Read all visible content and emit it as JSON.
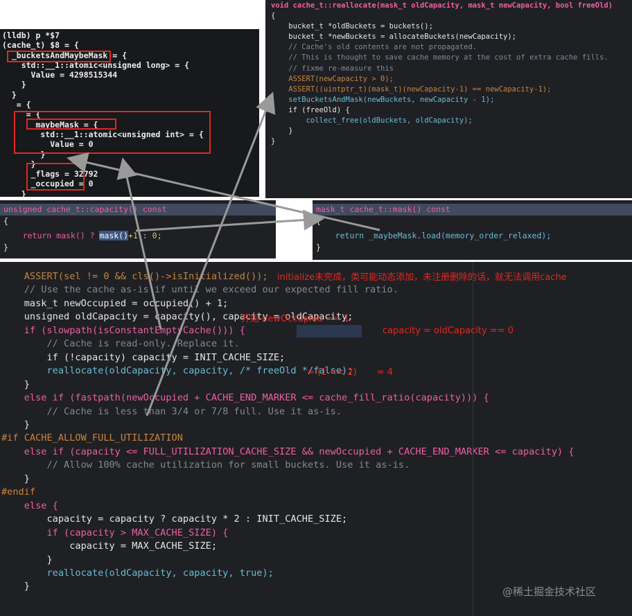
{
  "lldb": {
    "lines": [
      "(lldb) p *$7",
      "(cache_t) $8 = {",
      "  _bucketsAndMaybeMask = {",
      "    std::__1::atomic<unsigned long> = {",
      "      Value = 4298515344",
      "    }",
      "  }",
      "   = {",
      "     = {",
      "      _maybeMask = {",
      "        std::__1::atomic<unsigned int> = {",
      "          Value = 0",
      "        }",
      "      }",
      "      _flags = 32792",
      "      _occupied = 0",
      "    }"
    ]
  },
  "reallocate_code": {
    "lines": [
      "void cache_t::reallocate(mask_t oldCapacity, mask_t newCapacity, bool freeOld)",
      "{",
      "    bucket_t *oldBuckets = buckets();",
      "    bucket_t *newBuckets = allocateBuckets(newCapacity);",
      "",
      "    // Cache's old contents are not propagated.",
      "    // This is thought to save cache memory at the cost of extra cache fills.",
      "    // fixme re-measure this",
      "",
      "    ASSERT(newCapacity > 0);",
      "    ASSERT((uintptr_t)(mask_t)(newCapacity-1) == newCapacity-1);",
      "",
      "    setBucketsAndMask(newBuckets, newCapacity - 1);",
      "",
      "    if (freeOld) {",
      "        collect_free(oldBuckets, oldCapacity);",
      "    }",
      "}"
    ]
  },
  "capacity_code": {
    "header": "unsigned cache_t::capacity() const",
    "brace_open": "{",
    "body_pre": "    return mask() ? ",
    "body_hl": "mask()",
    "body_post": "+1 : 0;",
    "brace_close": "}"
  },
  "mask_code": {
    "header": "mask_t cache_t::mask() const",
    "brace_open": "{",
    "body": "    return _maybeMask.load(memory_order_relaxed);",
    "brace_close": "}"
  },
  "main_code": {
    "lines": [
      "    ASSERT(sel != 0 && cls()->isInitialized());",
      "",
      "    // Use the cache as-is if until we exceed our expected fill ratio.",
      "    mask_t newOccupied = occupied() + 1;",
      "    unsigned oldCapacity = capacity(), capacity = oldCapacity;",
      "    if (slowpath(isConstantEmptyCache())) {",
      "        // Cache is read-only. Replace it.",
      "        if (!capacity) capacity = INIT_CACHE_SIZE;",
      "        reallocate(oldCapacity, capacity, /* freeOld */false);",
      "    }",
      "    else if (fastpath(newOccupied + CACHE_END_MARKER <= cache_fill_ratio(capacity))) {",
      "        // Cache is less than 3/4 or 7/8 full. Use it as-is.",
      "    }",
      "#if CACHE_ALLOW_FULL_UTILIZATION",
      "    else if (capacity <= FULL_UTILIZATION_CACHE_SIZE && newOccupied + CACHE_END_MARKER <= capacity) {",
      "        // Allow 100% cache utilization for small buckets. Use it as-is.",
      "    }",
      "#endif",
      "    else {",
      "        capacity = capacity ? capacity * 2 : INIT_CACHE_SIZE;",
      "        if (capacity > MAX_CACHE_SIZE) {",
      "            capacity = MAX_CACHE_SIZE;",
      "        }",
      "        reallocate(oldCapacity, capacity, true);",
      "    }"
    ]
  },
  "annotations": {
    "initialize_note": "initialize未完成，类可能动态添加，未注册删除的话，就无法调用cache",
    "occupied_note": "开始 newOccupied == 1",
    "capacity_note": "capacity = oldCapacity == 0",
    "init_size_note": "= (1 << 2)       = 4"
  },
  "watermark": "@稀土掘金技术社区",
  "colors": {
    "code_bg": "#1f2024",
    "highlight_row": "#414a5e",
    "annotation_red": "#e0291f",
    "arrow_gray": "#9a9a9a"
  }
}
